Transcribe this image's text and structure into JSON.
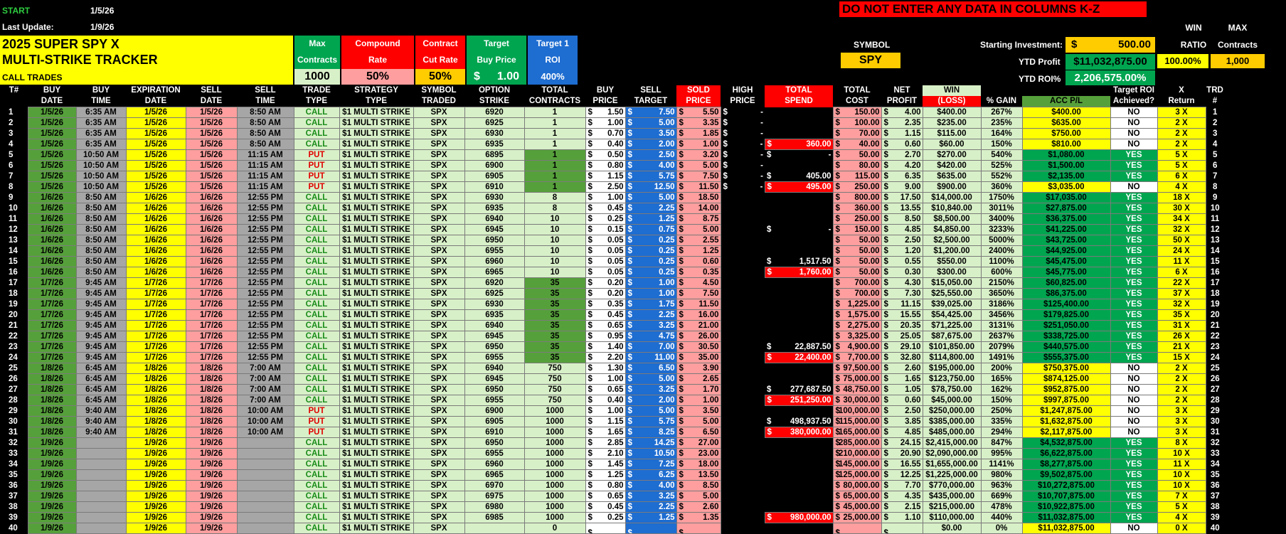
{
  "top": {
    "start_label": "START",
    "start_date": "1/5/26",
    "last_update_label": "Last Update:",
    "last_update_date": "1/9/26",
    "warning": "DO NOT ENTER ANY DATA IN COLUMNS K-Z"
  },
  "title": {
    "line1": "2025 SUPER SPY X",
    "line2": "MULTI-STRIKE TRACKER",
    "line3": "CALL TRADES"
  },
  "params": {
    "max_contracts_label_1": "Max",
    "max_contracts_label_2": "Contracts",
    "max_contracts_value": "1000",
    "compound_label_1": "Compound",
    "compound_label_2": "Rate",
    "compound_value": "50%",
    "cut_label_1": "Contract",
    "cut_label_2": "Cut Rate",
    "cut_value": "50%",
    "target_label_1": "Target",
    "target_label_2": "Buy Price",
    "target_cur": "$",
    "target_value": "1.00",
    "roi_label_1": "Target 1",
    "roi_label_2": "ROI",
    "roi_value": "400%"
  },
  "summary": {
    "symbol_label": "SYMBOL",
    "symbol_value": "SPY",
    "starting_label": "Starting Investment:",
    "starting_cur": "$",
    "starting_value": "500.00",
    "ytd_profit_label": "YTD Profit",
    "ytd_profit_value": "$11,032,875.00",
    "ytd_roi_label": "YTD ROI%",
    "ytd_roi_value": "2,206,575.00%",
    "win_label_1": "WIN",
    "win_label_2": "RATIO",
    "win_value": "100.00%",
    "max_label_1": "MAX",
    "max_label_2": "Contracts",
    "max_value": "1,000"
  },
  "headers": [
    [
      "T#",
      ""
    ],
    [
      "BUY",
      "DATE"
    ],
    [
      "BUY",
      "TIME"
    ],
    [
      "EXPIRATION",
      "DATE"
    ],
    [
      "SELL",
      "DATE"
    ],
    [
      "SELL",
      "TIME"
    ],
    [
      "TRADE",
      "TYPE"
    ],
    [
      "STRATEGY",
      "TYPE"
    ],
    [
      "SYMBOL",
      "TRADED"
    ],
    [
      "OPTION",
      "STRIKE"
    ],
    [
      "TOTAL",
      "CONTRACTS"
    ],
    [
      "BUY",
      "PRICE"
    ],
    [
      "SELL",
      "TARGET"
    ],
    [
      "SOLD",
      "PRICE"
    ],
    [
      "HIGH",
      "PRICE"
    ],
    [
      "TOTAL",
      "SPEND"
    ],
    [
      "TOTAL",
      "COST"
    ],
    [
      "NET",
      "PROFIT"
    ],
    [
      "WIN",
      "(LOSS)"
    ],
    [
      "",
      "% GAIN"
    ],
    [
      "",
      "ACC P/L"
    ],
    [
      "Target ROI",
      "Achieved?"
    ],
    [
      "X",
      "Return"
    ],
    [
      "TRD",
      "#"
    ]
  ],
  "rows": [
    [
      "1",
      "1/5/26",
      "6:35 AM",
      "1/5/26",
      "1/5/26",
      "8:50 AM",
      "CALL",
      "$1 MULTI STRIKE",
      "SPX",
      "6920",
      "1",
      "1.50",
      "7.50",
      "5.50",
      "-",
      "",
      "150.00",
      "4.00",
      "$400.00",
      "267%",
      "$400.00",
      "NO",
      "3 X",
      "1"
    ],
    [
      "2",
      "1/5/26",
      "6:35 AM",
      "1/5/26",
      "1/5/26",
      "8:50 AM",
      "CALL",
      "$1 MULTI STRIKE",
      "SPX",
      "6925",
      "1",
      "1.00",
      "5.00",
      "3.35",
      "-",
      "",
      "100.00",
      "2.35",
      "$235.00",
      "235%",
      "$635.00",
      "NO",
      "2 X",
      "2"
    ],
    [
      "3",
      "1/5/26",
      "6:35 AM",
      "1/5/26",
      "1/5/26",
      "8:50 AM",
      "CALL",
      "$1 MULTI STRIKE",
      "SPX",
      "6930",
      "1",
      "0.70",
      "3.50",
      "1.85",
      "-",
      "",
      "70.00",
      "1.15",
      "$115.00",
      "164%",
      "$750.00",
      "NO",
      "2 X",
      "3"
    ],
    [
      "4",
      "1/5/26",
      "6:35 AM",
      "1/5/26",
      "1/5/26",
      "8:50 AM",
      "CALL",
      "$1 MULTI STRIKE",
      "SPX",
      "6935",
      "1",
      "0.40",
      "2.00",
      "1.00",
      "-",
      "360.00",
      "40.00",
      "0.60",
      "$60.00",
      "150%",
      "$810.00",
      "NO",
      "2 X",
      "4"
    ],
    [
      "5",
      "1/5/26",
      "10:50 AM",
      "1/5/26",
      "1/5/26",
      "11:15 AM",
      "PUT",
      "$1 MULTI STRIKE",
      "SPX",
      "6895",
      "1",
      "0.50",
      "2.50",
      "3.20",
      "-",
      "-",
      "50.00",
      "2.70",
      "$270.00",
      "540%",
      "$1,080.00",
      "YES",
      "5 X",
      "5"
    ],
    [
      "6",
      "1/5/26",
      "10:50 AM",
      "1/5/26",
      "1/5/26",
      "11:15 AM",
      "PUT",
      "$1 MULTI STRIKE",
      "SPX",
      "6900",
      "1",
      "0.80",
      "4.00",
      "5.00",
      "-",
      "",
      "80.00",
      "4.20",
      "$420.00",
      "525%",
      "$1,500.00",
      "YES",
      "5 X",
      "6"
    ],
    [
      "7",
      "1/5/26",
      "10:50 AM",
      "1/5/26",
      "1/5/26",
      "11:15 AM",
      "PUT",
      "$1 MULTI STRIKE",
      "SPX",
      "6905",
      "1",
      "1.15",
      "5.75",
      "7.50",
      "-",
      "405.00",
      "115.00",
      "6.35",
      "$635.00",
      "552%",
      "$2,135.00",
      "YES",
      "6 X",
      "7"
    ],
    [
      "8",
      "1/5/26",
      "10:50 AM",
      "1/5/26",
      "1/5/26",
      "11:15 AM",
      "PUT",
      "$1 MULTI STRIKE",
      "SPX",
      "6910",
      "1",
      "2.50",
      "12.50",
      "11.50",
      "-",
      "495.00",
      "250.00",
      "9.00",
      "$900.00",
      "360%",
      "$3,035.00",
      "NO",
      "4 X",
      "8"
    ],
    [
      "9",
      "1/6/26",
      "8:50 AM",
      "1/6/26",
      "1/6/26",
      "12:55 PM",
      "CALL",
      "$1 MULTI STRIKE",
      "SPX",
      "6930",
      "8",
      "1.00",
      "5.00",
      "18.50",
      "",
      "",
      "800.00",
      "17.50",
      "$14,000.00",
      "1750%",
      "$17,035.00",
      "YES",
      "18 X",
      "9"
    ],
    [
      "10",
      "1/6/26",
      "8:50 AM",
      "1/6/26",
      "1/6/26",
      "12:55 PM",
      "CALL",
      "$1 MULTI STRIKE",
      "SPX",
      "6935",
      "8",
      "0.45",
      "2.25",
      "14.00",
      "",
      "",
      "360.00",
      "13.55",
      "$10,840.00",
      "3011%",
      "$27,875.00",
      "YES",
      "30 X",
      "10"
    ],
    [
      "11",
      "1/6/26",
      "8:50 AM",
      "1/6/26",
      "1/6/26",
      "12:55 PM",
      "CALL",
      "$1 MULTI STRIKE",
      "SPX",
      "6940",
      "10",
      "0.25",
      "1.25",
      "8.75",
      "",
      "",
      "250.00",
      "8.50",
      "$8,500.00",
      "3400%",
      "$36,375.00",
      "YES",
      "34 X",
      "11"
    ],
    [
      "12",
      "1/6/26",
      "8:50 AM",
      "1/6/26",
      "1/6/26",
      "12:55 PM",
      "CALL",
      "$1 MULTI STRIKE",
      "SPX",
      "6945",
      "10",
      "0.15",
      "0.75",
      "5.00",
      "",
      "-",
      "150.00",
      "4.85",
      "$4,850.00",
      "3233%",
      "$41,225.00",
      "YES",
      "32 X",
      "12"
    ],
    [
      "13",
      "1/6/26",
      "8:50 AM",
      "1/6/26",
      "1/6/26",
      "12:55 PM",
      "CALL",
      "$1 MULTI STRIKE",
      "SPX",
      "6950",
      "10",
      "0.05",
      "0.25",
      "2.55",
      "",
      "",
      "50.00",
      "2.50",
      "$2,500.00",
      "5000%",
      "$43,725.00",
      "YES",
      "50 X",
      "13"
    ],
    [
      "14",
      "1/6/26",
      "8:50 AM",
      "1/6/26",
      "1/6/26",
      "12:55 PM",
      "CALL",
      "$1 MULTI STRIKE",
      "SPX",
      "6955",
      "10",
      "0.05",
      "0.25",
      "1.25",
      "",
      "",
      "50.00",
      "1.20",
      "$1,200.00",
      "2400%",
      "$44,925.00",
      "YES",
      "24 X",
      "14"
    ],
    [
      "15",
      "1/6/26",
      "8:50 AM",
      "1/6/26",
      "1/6/26",
      "12:55 PM",
      "CALL",
      "$1 MULTI STRIKE",
      "SPX",
      "6960",
      "10",
      "0.05",
      "0.25",
      "0.60",
      "",
      "1,517.50",
      "50.00",
      "0.55",
      "$550.00",
      "1100%",
      "$45,475.00",
      "YES",
      "11 X",
      "15"
    ],
    [
      "16",
      "1/6/26",
      "8:50 AM",
      "1/6/26",
      "1/6/26",
      "12:55 PM",
      "CALL",
      "$1 MULTI STRIKE",
      "SPX",
      "6965",
      "10",
      "0.05",
      "0.25",
      "0.35",
      "",
      "1,760.00",
      "50.00",
      "0.30",
      "$300.00",
      "600%",
      "$45,775.00",
      "YES",
      "6 X",
      "16"
    ],
    [
      "17",
      "1/7/26",
      "9:45 AM",
      "1/7/26",
      "1/7/26",
      "12:55 PM",
      "CALL",
      "$1 MULTI STRIKE",
      "SPX",
      "6920",
      "35",
      "0.20",
      "1.00",
      "4.50",
      "",
      "",
      "700.00",
      "4.30",
      "$15,050.00",
      "2150%",
      "$60,825.00",
      "YES",
      "22 X",
      "17"
    ],
    [
      "18",
      "1/7/26",
      "9:45 AM",
      "1/7/26",
      "1/7/26",
      "12:55 PM",
      "CALL",
      "$1 MULTI STRIKE",
      "SPX",
      "6925",
      "35",
      "0.20",
      "1.00",
      "7.50",
      "",
      "",
      "700.00",
      "7.30",
      "$25,550.00",
      "3650%",
      "$86,375.00",
      "YES",
      "37 X",
      "18"
    ],
    [
      "19",
      "1/7/26",
      "9:45 AM",
      "1/7/26",
      "1/7/26",
      "12:55 PM",
      "CALL",
      "$1 MULTI STRIKE",
      "SPX",
      "6930",
      "35",
      "0.35",
      "1.75",
      "11.50",
      "",
      "",
      "1,225.00",
      "11.15",
      "$39,025.00",
      "3186%",
      "$125,400.00",
      "YES",
      "32 X",
      "19"
    ],
    [
      "20",
      "1/7/26",
      "9:45 AM",
      "1/7/26",
      "1/7/26",
      "12:55 PM",
      "CALL",
      "$1 MULTI STRIKE",
      "SPX",
      "6935",
      "35",
      "0.45",
      "2.25",
      "16.00",
      "",
      "",
      "1,575.00",
      "15.55",
      "$54,425.00",
      "3456%",
      "$179,825.00",
      "YES",
      "35 X",
      "20"
    ],
    [
      "21",
      "1/7/26",
      "9:45 AM",
      "1/7/26",
      "1/7/26",
      "12:55 PM",
      "CALL",
      "$1 MULTI STRIKE",
      "SPX",
      "6940",
      "35",
      "0.65",
      "3.25",
      "21.00",
      "",
      "",
      "2,275.00",
      "20.35",
      "$71,225.00",
      "3131%",
      "$251,050.00",
      "YES",
      "31 X",
      "21"
    ],
    [
      "22",
      "1/7/26",
      "9:45 AM",
      "1/7/26",
      "1/7/26",
      "12:55 PM",
      "CALL",
      "$1 MULTI STRIKE",
      "SPX",
      "6945",
      "35",
      "0.95",
      "4.75",
      "26.00",
      "",
      "",
      "3,325.00",
      "25.05",
      "$87,675.00",
      "2637%",
      "$338,725.00",
      "YES",
      "26 X",
      "22"
    ],
    [
      "23",
      "1/7/26",
      "9:45 AM",
      "1/7/26",
      "1/7/26",
      "12:55 PM",
      "CALL",
      "$1 MULTI STRIKE",
      "SPX",
      "6950",
      "35",
      "1.40",
      "7.00",
      "30.50",
      "",
      "22,887.50",
      "4,900.00",
      "29.10",
      "$101,850.00",
      "2079%",
      "$440,575.00",
      "YES",
      "21 X",
      "23"
    ],
    [
      "24",
      "1/7/26",
      "9:45 AM",
      "1/7/26",
      "1/7/26",
      "12:55 PM",
      "CALL",
      "$1 MULTI STRIKE",
      "SPX",
      "6955",
      "35",
      "2.20",
      "11.00",
      "35.00",
      "",
      "22,400.00",
      "7,700.00",
      "32.80",
      "$114,800.00",
      "1491%",
      "$555,375.00",
      "YES",
      "15 X",
      "24"
    ],
    [
      "25",
      "1/8/26",
      "6:45 AM",
      "1/8/26",
      "1/8/26",
      "7:00 AM",
      "CALL",
      "$1 MULTI STRIKE",
      "SPX",
      "6940",
      "750",
      "1.30",
      "6.50",
      "3.90",
      "",
      "",
      "97,500.00",
      "2.60",
      "$195,000.00",
      "200%",
      "$750,375.00",
      "NO",
      "2 X",
      "25"
    ],
    [
      "26",
      "1/8/26",
      "6:45 AM",
      "1/8/26",
      "1/8/26",
      "7:00 AM",
      "CALL",
      "$1 MULTI STRIKE",
      "SPX",
      "6945",
      "750",
      "1.00",
      "5.00",
      "2.65",
      "",
      "",
      "75,000.00",
      "1.65",
      "$123,750.00",
      "165%",
      "$874,125.00",
      "NO",
      "2 X",
      "26"
    ],
    [
      "27",
      "1/8/26",
      "6:45 AM",
      "1/8/26",
      "1/8/26",
      "7:00 AM",
      "CALL",
      "$1 MULTI STRIKE",
      "SPX",
      "6950",
      "750",
      "0.65",
      "3.25",
      "1.70",
      "",
      "277,687.50",
      "48,750.00",
      "1.05",
      "$78,750.00",
      "162%",
      "$952,875.00",
      "NO",
      "2 X",
      "27"
    ],
    [
      "28",
      "1/8/26",
      "6:45 AM",
      "1/8/26",
      "1/8/26",
      "7:00 AM",
      "CALL",
      "$1 MULTI STRIKE",
      "SPX",
      "6955",
      "750",
      "0.40",
      "2.00",
      "1.00",
      "",
      "251,250.00",
      "30,000.00",
      "0.60",
      "$45,000.00",
      "150%",
      "$997,875.00",
      "NO",
      "2 X",
      "28"
    ],
    [
      "29",
      "1/8/26",
      "9:40 AM",
      "1/8/26",
      "1/8/26",
      "10:00 AM",
      "PUT",
      "$1 MULTI STRIKE",
      "SPX",
      "6900",
      "1000",
      "1.00",
      "5.00",
      "3.50",
      "",
      "",
      "100,000.00",
      "2.50",
      "$250,000.00",
      "250%",
      "$1,247,875.00",
      "NO",
      "3 X",
      "29"
    ],
    [
      "30",
      "1/8/26",
      "9:40 AM",
      "1/8/26",
      "1/8/26",
      "10:00 AM",
      "PUT",
      "$1 MULTI STRIKE",
      "SPX",
      "6905",
      "1000",
      "1.15",
      "5.75",
      "5.00",
      "",
      "498,937.50",
      "115,000.00",
      "3.85",
      "$385,000.00",
      "335%",
      "$1,632,875.00",
      "NO",
      "3 X",
      "30"
    ],
    [
      "31",
      "1/8/26",
      "9:40 AM",
      "1/8/26",
      "1/8/26",
      "10:00 AM",
      "PUT",
      "$1 MULTI STRIKE",
      "SPX",
      "6910",
      "1000",
      "1.65",
      "8.25",
      "6.50",
      "",
      "380,000.00",
      "165,000.00",
      "4.85",
      "$485,000.00",
      "294%",
      "$2,117,875.00",
      "NO",
      "3 X",
      "31"
    ],
    [
      "32",
      "1/9/26",
      "",
      "1/9/26",
      "1/9/26",
      "",
      "CALL",
      "$1 MULTI STRIKE",
      "SPX",
      "6950",
      "1000",
      "2.85",
      "14.25",
      "27.00",
      "",
      "",
      "285,000.00",
      "24.15",
      "$2,415,000.00",
      "847%",
      "$4,532,875.00",
      "YES",
      "8 X",
      "32"
    ],
    [
      "33",
      "1/9/26",
      "",
      "1/9/26",
      "1/9/26",
      "",
      "CALL",
      "$1 MULTI STRIKE",
      "SPX",
      "6955",
      "1000",
      "2.10",
      "10.50",
      "23.00",
      "",
      "",
      "210,000.00",
      "20.90",
      "$2,090,000.00",
      "995%",
      "$6,622,875.00",
      "YES",
      "10 X",
      "33"
    ],
    [
      "34",
      "1/9/26",
      "",
      "1/9/26",
      "1/9/26",
      "",
      "CALL",
      "$1 MULTI STRIKE",
      "SPX",
      "6960",
      "1000",
      "1.45",
      "7.25",
      "18.00",
      "",
      "",
      "145,000.00",
      "16.55",
      "$1,655,000.00",
      "1141%",
      "$8,277,875.00",
      "YES",
      "11 X",
      "34"
    ],
    [
      "35",
      "1/9/26",
      "",
      "1/9/26",
      "1/9/26",
      "",
      "CALL",
      "$1 MULTI STRIKE",
      "SPX",
      "6965",
      "1000",
      "1.25",
      "6.25",
      "13.50",
      "",
      "",
      "125,000.00",
      "12.25",
      "$1,225,000.00",
      "980%",
      "$9,502,875.00",
      "YES",
      "10 X",
      "35"
    ],
    [
      "36",
      "1/9/26",
      "",
      "1/9/26",
      "1/9/26",
      "",
      "CALL",
      "$1 MULTI STRIKE",
      "SPX",
      "6970",
      "1000",
      "0.80",
      "4.00",
      "8.50",
      "",
      "",
      "80,000.00",
      "7.70",
      "$770,000.00",
      "963%",
      "$10,272,875.00",
      "YES",
      "10 X",
      "36"
    ],
    [
      "37",
      "1/9/26",
      "",
      "1/9/26",
      "1/9/26",
      "",
      "CALL",
      "$1 MULTI STRIKE",
      "SPX",
      "6975",
      "1000",
      "0.65",
      "3.25",
      "5.00",
      "",
      "",
      "65,000.00",
      "4.35",
      "$435,000.00",
      "669%",
      "$10,707,875.00",
      "YES",
      "7 X",
      "37"
    ],
    [
      "38",
      "1/9/26",
      "",
      "1/9/26",
      "1/9/26",
      "",
      "CALL",
      "$1 MULTI STRIKE",
      "SPX",
      "6980",
      "1000",
      "0.45",
      "2.25",
      "2.60",
      "",
      "",
      "45,000.00",
      "2.15",
      "$215,000.00",
      "478%",
      "$10,922,875.00",
      "YES",
      "5 X",
      "38"
    ],
    [
      "39",
      "1/9/26",
      "",
      "1/9/26",
      "1/9/26",
      "",
      "CALL",
      "$1 MULTI STRIKE",
      "SPX",
      "6985",
      "1000",
      "0.25",
      "1.25",
      "1.35",
      "",
      "980,000.00",
      "25,000.00",
      "1.10",
      "$110,000.00",
      "440%",
      "$11,032,875.00",
      "YES",
      "4 X",
      "39"
    ],
    [
      "40",
      "1/9/26",
      "",
      "1/9/26",
      "1/9/26",
      "",
      "CALL",
      "$1 MULTI STRIKE",
      "SPX",
      "",
      "0",
      "",
      "",
      "",
      "",
      "",
      "",
      "",
      "$0.00",
      "0%",
      "$11,032,875.00",
      "NO",
      "0 X",
      "40"
    ]
  ]
}
